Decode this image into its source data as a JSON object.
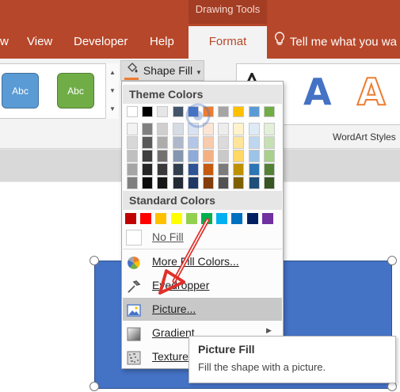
{
  "title_bar": {
    "contextual_label": "Drawing Tools"
  },
  "tabs": [
    {
      "label": "w"
    },
    {
      "label": "View"
    },
    {
      "label": "Developer"
    },
    {
      "label": "Help"
    },
    {
      "label": "Format"
    }
  ],
  "tell_me": {
    "label": "Tell me what you wa"
  },
  "ribbon": {
    "shape_styles": [
      "Abc",
      "Abc"
    ],
    "shape_fill_label": "Shape Fill",
    "wordart_letters": [
      "A",
      "A"
    ],
    "wordart_group_label": "WordArt Styles"
  },
  "menu": {
    "theme_colors_header": "Theme Colors",
    "standard_colors_header": "Standard Colors",
    "theme_colors": [
      [
        "#ffffff",
        "#000000",
        "#e7e6e6",
        "#44546a",
        "#4472c4",
        "#ed7d31",
        "#a5a5a5",
        "#ffc000",
        "#5b9bd5",
        "#70ad47"
      ],
      [
        "#f2f2f2",
        "#7f7f7f",
        "#d0cece",
        "#d6dce4",
        "#d9e2f3",
        "#fbe5d5",
        "#ededed",
        "#fff2cc",
        "#deebf6",
        "#e2efd9"
      ],
      [
        "#d8d8d8",
        "#595959",
        "#aeabab",
        "#adb9ca",
        "#b4c6e7",
        "#f7cbac",
        "#dbdbdb",
        "#fee599",
        "#bdd7ee",
        "#c5e0b3"
      ],
      [
        "#bfbfbf",
        "#3f3f3f",
        "#757070",
        "#8496b0",
        "#8eaadb",
        "#f4b183",
        "#c9c9c9",
        "#ffd966",
        "#9dc3e6",
        "#a8d08d"
      ],
      [
        "#a5a5a5",
        "#262626",
        "#3a3838",
        "#323f4f",
        "#2f5496",
        "#c55a11",
        "#7b7b7b",
        "#bf9000",
        "#2e75b5",
        "#538135"
      ],
      [
        "#7f7f7f",
        "#0c0c0c",
        "#171616",
        "#222a35",
        "#1f3864",
        "#833c0b",
        "#525252",
        "#7f6000",
        "#1e4e79",
        "#375623"
      ]
    ],
    "standard_colors": [
      "#c00000",
      "#ff0000",
      "#ffc000",
      "#ffff00",
      "#92d050",
      "#00b050",
      "#00b0f0",
      "#0070c0",
      "#002060",
      "#7030a0"
    ],
    "no_fill": "No Fill",
    "items": [
      {
        "label": "More Fill Colors...",
        "icon": "color-wheel-icon"
      },
      {
        "label": "Eyedropper",
        "icon": "eyedropper-icon"
      },
      {
        "label": "Picture...",
        "icon": "picture-icon"
      },
      {
        "label": "Gradient",
        "icon": "gradient-icon"
      },
      {
        "label": "Texture",
        "icon": "texture-icon"
      }
    ]
  },
  "tooltip": {
    "title": "Picture Fill",
    "description": "Fill the shape with a picture."
  },
  "colors": {
    "accent": "#b7472a",
    "shape_fill": "#4472c4",
    "arrow": "#e0302a"
  }
}
